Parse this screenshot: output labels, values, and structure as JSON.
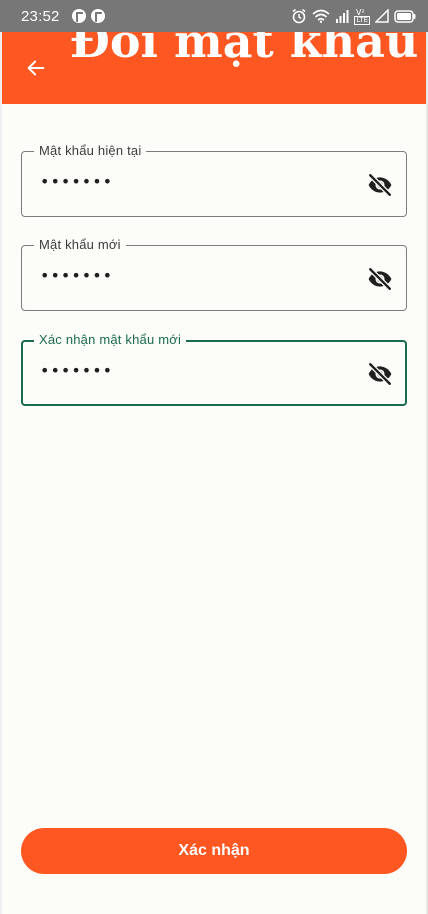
{
  "status_bar": {
    "time": "23:52",
    "network_label": "LTE"
  },
  "header": {
    "title": "Đổi mật khẩu"
  },
  "form": {
    "fields": [
      {
        "label": "Mật khẩu hiện tại",
        "value": "•••••••",
        "focused": false
      },
      {
        "label": "Mật khẩu mới",
        "value": "•••••••",
        "focused": false
      },
      {
        "label": "Xác nhận mật khẩu mới",
        "value": "•••••••",
        "focused": true
      }
    ],
    "submit_label": "Xác nhận"
  },
  "icons": {
    "back": "arrow-left-icon",
    "visibility": "eye-off-icon",
    "status_notifications": [
      "app-notification-icon",
      "app-notification-icon"
    ],
    "status_system": [
      "alarm-icon",
      "wifi-icon",
      "signal-icon",
      "battery-icon"
    ]
  },
  "colors": {
    "accent": "#ff5722",
    "focus": "#1b6b4f",
    "background": "#fcfcf8",
    "status_bar": "#777777"
  }
}
